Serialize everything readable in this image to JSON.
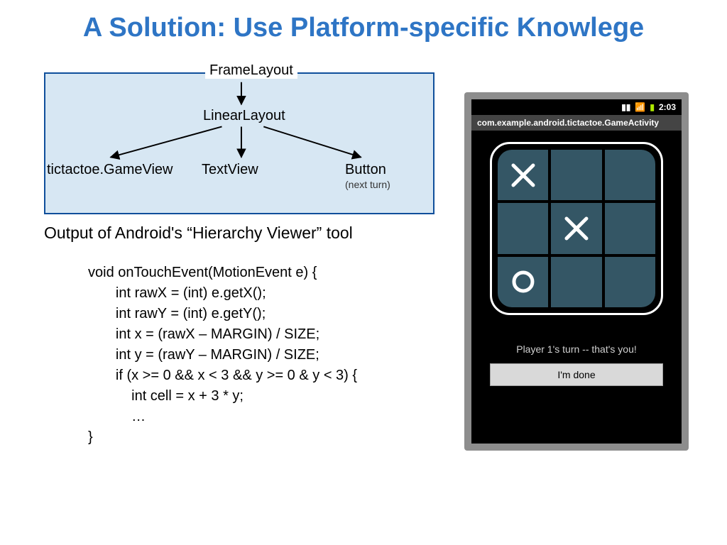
{
  "title": "A Solution: Use Platform-specific Knowlege",
  "diagram": {
    "frame": "FrameLayout",
    "linear": "LinearLayout",
    "leaves": {
      "game": "tictactoe.GameView",
      "text": "TextView",
      "button": "Button",
      "button_sub": "(next turn)"
    }
  },
  "hierarchy_caption": "Output of Android's “Hierarchy Viewer” tool",
  "code": "void onTouchEvent(MotionEvent e) {\n       int rawX = (int) e.getX();\n       int rawY = (int) e.getY();\n       int x = (rawX – MARGIN) / SIZE;\n       int y = (rawY – MARGIN) / SIZE;\n       if (x >= 0 && x < 3 && y >= 0 & y < 3) {\n           int cell = x + 3 * y;\n           …\n}",
  "phone": {
    "time": "2:03",
    "activity": "com.example.android.tictactoe.GameActivity",
    "turn_text": "Player 1's turn -- that's you!",
    "done_label": "I'm done",
    "board": [
      [
        "X",
        "",
        ""
      ],
      [
        "",
        "X",
        ""
      ],
      [
        "O",
        "",
        ""
      ]
    ]
  }
}
